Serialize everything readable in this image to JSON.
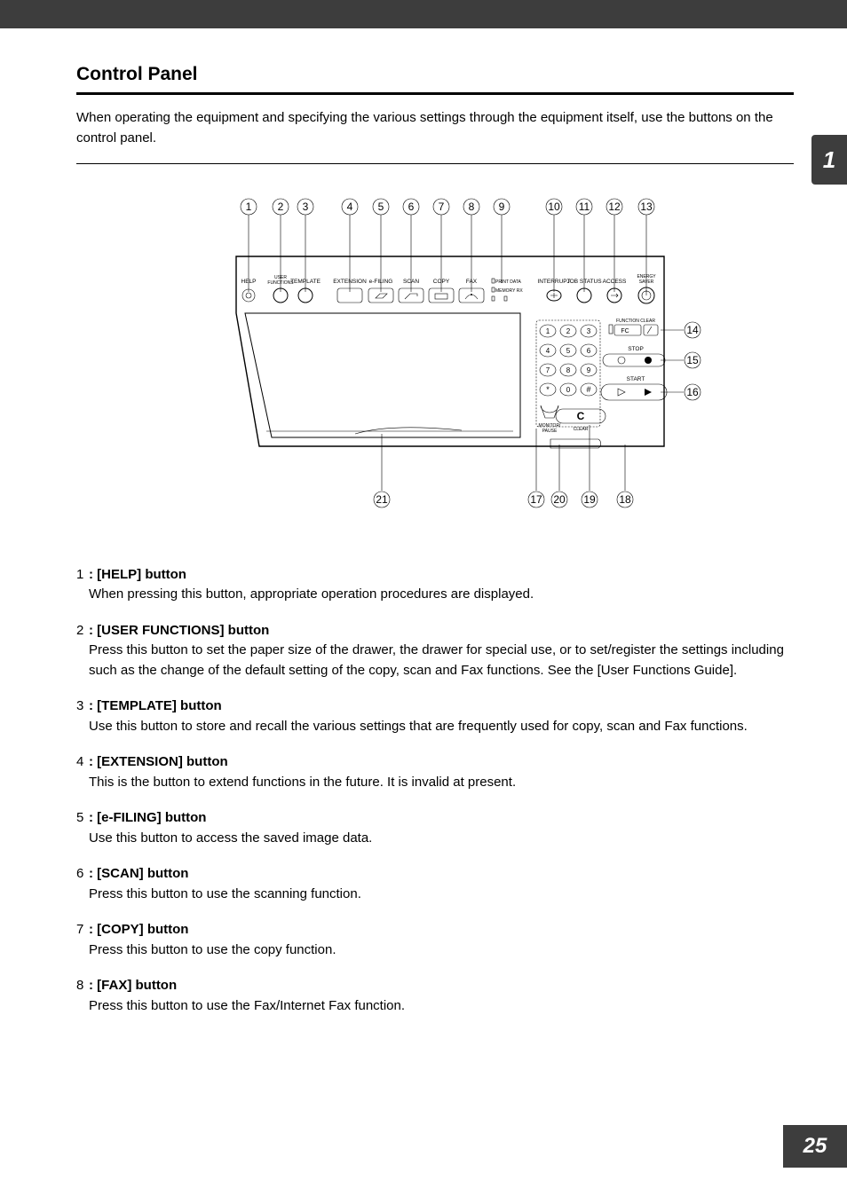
{
  "topbar": {
    "visible": true
  },
  "side_tab": "1",
  "page_number": "25",
  "title": "Control Panel",
  "intro": "When operating the equipment and specifying the various settings through the equipment itself, use the buttons on the control panel.",
  "diagram": {
    "callouts_top": [
      "1",
      "2",
      "3",
      "4",
      "5",
      "6",
      "7",
      "8",
      "9",
      "10",
      "11",
      "12",
      "13"
    ],
    "callouts_right": [
      "14",
      "15",
      "16"
    ],
    "callouts_bottom": [
      "21",
      "17",
      "20",
      "19",
      "18"
    ],
    "panel_labels": {
      "help": "HELP",
      "user_functions": "USER\nFUNCTIONS",
      "template": "TEMPLATE",
      "extension": "EXTENSION",
      "efiling": "e-FILING",
      "scan": "SCAN",
      "copy": "COPY",
      "fax": "FAX",
      "print_data": "PRINT DATA",
      "memory_rx": "MEMORY RX",
      "interrupt": "INTERRUPT",
      "job_status": "JOB STATUS",
      "access": "ACCESS",
      "energy_saver": "ENERGY\nSAVER",
      "function_clear": "FUNCTION CLEAR",
      "fc": "FC",
      "stop": "STOP",
      "start": "START",
      "monitor_pause": "MONITOR/\nPAUSE",
      "clear": "CLEAR",
      "c": "C",
      "keys": [
        "1",
        "2",
        "3",
        "4",
        "5",
        "6",
        "7",
        "8",
        "9",
        "*",
        "0",
        "#"
      ]
    }
  },
  "items": [
    {
      "num": "1",
      "title": ": [HELP] button",
      "desc": "When pressing this button, appropriate operation procedures are displayed."
    },
    {
      "num": "2",
      "title": ": [USER FUNCTIONS] button",
      "desc": "Press this button to set the paper size of the drawer, the drawer for special use, or to set/register the settings including such as the change of the default setting of the copy, scan and Fax functions. See the [User Functions Guide]."
    },
    {
      "num": "3",
      "title": ": [TEMPLATE] button",
      "desc": "Use this button to store and recall the various settings that are frequently used for copy, scan and Fax functions."
    },
    {
      "num": "4",
      "title": ": [EXTENSION] button",
      "desc": "This is the button to extend functions in the future. It is invalid at present."
    },
    {
      "num": "5",
      "title": ": [e-FILING] button",
      "desc": "Use this button to access the saved image data."
    },
    {
      "num": "6",
      "title": ": [SCAN] button",
      "desc": "Press this button to use the scanning function."
    },
    {
      "num": "7",
      "title": ": [COPY] button",
      "desc": "Press this button to use the copy function."
    },
    {
      "num": "8",
      "title": ": [FAX] button",
      "desc": "Press this button to use the Fax/Internet Fax function."
    }
  ]
}
